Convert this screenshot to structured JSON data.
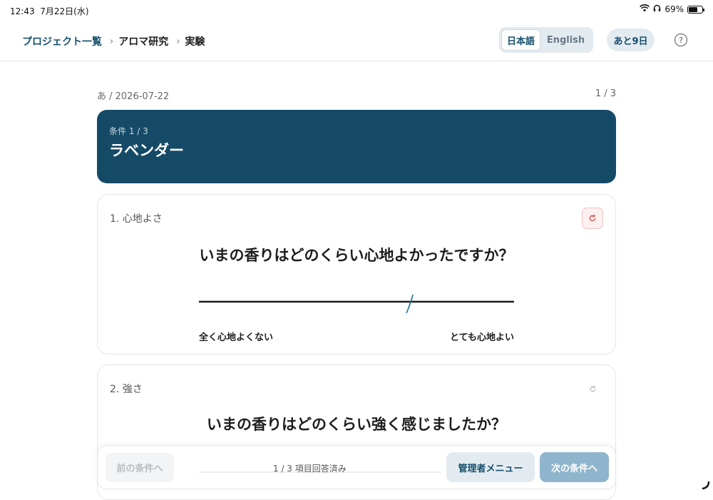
{
  "status_bar": {
    "time": "12:43",
    "date": "7月22日(水)",
    "battery": "69%",
    "battery_level": 0.69
  },
  "breadcrumb": {
    "root": "プロジェクト一覧",
    "project": "アロマ研究",
    "current": "実験"
  },
  "language": {
    "ja": "日本語",
    "en": "English",
    "selected": "ja"
  },
  "days_left": "あと9日",
  "help": "?",
  "meta": {
    "session": "あ / 2026-07-22",
    "page": "1 / 3"
  },
  "condition": {
    "label": "条件 1 / 3",
    "name": "ラベンダー"
  },
  "questions": [
    {
      "number": "1. 心地よさ",
      "text": "いまの香りはどのくらい心地よかったですか？",
      "left_label": "全く心地よくない",
      "right_label": "とても心地よい",
      "value": 0.67
    },
    {
      "number": "2. 強さ",
      "text": "いまの香りはどのくらい強く感じましたか？"
    }
  ],
  "footer": {
    "prev": "前の条件へ",
    "progress": "1 / 3 項目回答済み",
    "admin": "管理者メニュー",
    "next": "次の条件へ"
  },
  "colors": {
    "brand": "#154a66",
    "accent_light": "#e3ebf1",
    "next_disabled": "#8fb5cc",
    "reset_red": "#d9534f",
    "marker": "#1f6f95"
  },
  "icons": [
    "wifi-icon",
    "headphones-icon",
    "battery-icon",
    "help-icon",
    "reset-icon",
    "chevron-right-icon"
  ]
}
